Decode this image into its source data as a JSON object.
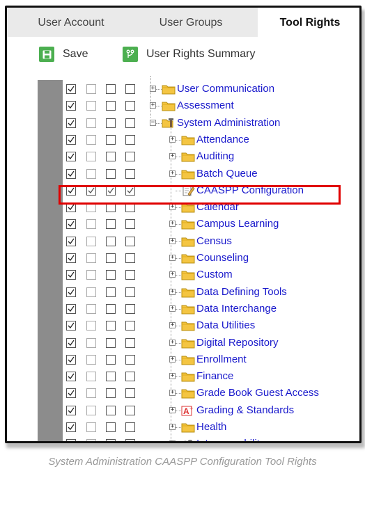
{
  "tabs": [
    {
      "label": "User Account",
      "active": false
    },
    {
      "label": "User Groups",
      "active": false
    },
    {
      "label": "Tool Rights",
      "active": true
    }
  ],
  "toolbar": {
    "save_label": "Save",
    "summary_label": "User Rights Summary",
    "save_icon": "floppy-disk-icon",
    "summary_icon": "branch-icon"
  },
  "colors": {
    "accent": "#4caf50",
    "link": "#1a1acc",
    "highlight": "#e00000"
  },
  "tree": [
    {
      "label": "User Communication",
      "level": 0,
      "icon": "folder-icon",
      "expander": "+",
      "checks": [
        true,
        false,
        false,
        false
      ]
    },
    {
      "label": "Assessment",
      "level": 0,
      "icon": "folder-icon",
      "expander": "+",
      "checks": [
        true,
        false,
        false,
        false
      ]
    },
    {
      "label": "System Administration",
      "level": 0,
      "icon": "admin-tools-icon",
      "expander": "-",
      "checks": [
        true,
        false,
        false,
        false
      ]
    },
    {
      "label": "Attendance",
      "level": 1,
      "icon": "folder-icon",
      "expander": "+",
      "checks": [
        true,
        false,
        false,
        false
      ]
    },
    {
      "label": "Auditing",
      "level": 1,
      "icon": "folder-icon",
      "expander": "+",
      "checks": [
        true,
        false,
        false,
        false
      ]
    },
    {
      "label": "Batch Queue",
      "level": 1,
      "icon": "folder-icon",
      "expander": "+",
      "checks": [
        true,
        false,
        false,
        false
      ]
    },
    {
      "label": "CAASPP Configuration",
      "level": 1,
      "icon": "document-edit-icon",
      "expander": "",
      "checks": [
        true,
        true,
        true,
        true
      ],
      "highlighted": true
    },
    {
      "label": "Calendar",
      "level": 1,
      "icon": "folder-icon",
      "expander": "+",
      "checks": [
        true,
        false,
        false,
        false
      ]
    },
    {
      "label": "Campus Learning",
      "level": 1,
      "icon": "folder-icon",
      "expander": "+",
      "checks": [
        true,
        false,
        false,
        false
      ]
    },
    {
      "label": "Census",
      "level": 1,
      "icon": "folder-icon",
      "expander": "+",
      "checks": [
        true,
        false,
        false,
        false
      ]
    },
    {
      "label": "Counseling",
      "level": 1,
      "icon": "folder-icon",
      "expander": "+",
      "checks": [
        true,
        false,
        false,
        false
      ]
    },
    {
      "label": "Custom",
      "level": 1,
      "icon": "folder-icon",
      "expander": "+",
      "checks": [
        true,
        false,
        false,
        false
      ]
    },
    {
      "label": "Data Defining Tools",
      "level": 1,
      "icon": "folder-icon",
      "expander": "+",
      "checks": [
        true,
        false,
        false,
        false
      ]
    },
    {
      "label": "Data Interchange",
      "level": 1,
      "icon": "folder-icon",
      "expander": "+",
      "checks": [
        true,
        false,
        false,
        false
      ]
    },
    {
      "label": "Data Utilities",
      "level": 1,
      "icon": "folder-icon",
      "expander": "+",
      "checks": [
        true,
        false,
        false,
        false
      ]
    },
    {
      "label": "Digital Repository",
      "level": 1,
      "icon": "folder-icon",
      "expander": "+",
      "checks": [
        true,
        false,
        false,
        false
      ]
    },
    {
      "label": "Enrollment",
      "level": 1,
      "icon": "folder-icon",
      "expander": "+",
      "checks": [
        true,
        false,
        false,
        false
      ]
    },
    {
      "label": "Finance",
      "level": 1,
      "icon": "folder-icon",
      "expander": "+",
      "checks": [
        true,
        false,
        false,
        false
      ]
    },
    {
      "label": "Grade Book Guest Access",
      "level": 1,
      "icon": "folder-icon",
      "expander": "+",
      "checks": [
        true,
        false,
        false,
        false
      ]
    },
    {
      "label": "Grading & Standards",
      "level": 1,
      "icon": "grading-icon",
      "expander": "+",
      "checks": [
        true,
        false,
        false,
        false
      ]
    },
    {
      "label": "Health",
      "level": 1,
      "icon": "folder-icon",
      "expander": "+",
      "checks": [
        true,
        false,
        false,
        false
      ]
    },
    {
      "label": "Interoperability",
      "level": 1,
      "icon": "interoperability-icon",
      "expander": "+",
      "checks": [
        true,
        false,
        false,
        false
      ]
    }
  ],
  "caption": "System Administration CAASPP Configuration Tool Rights"
}
